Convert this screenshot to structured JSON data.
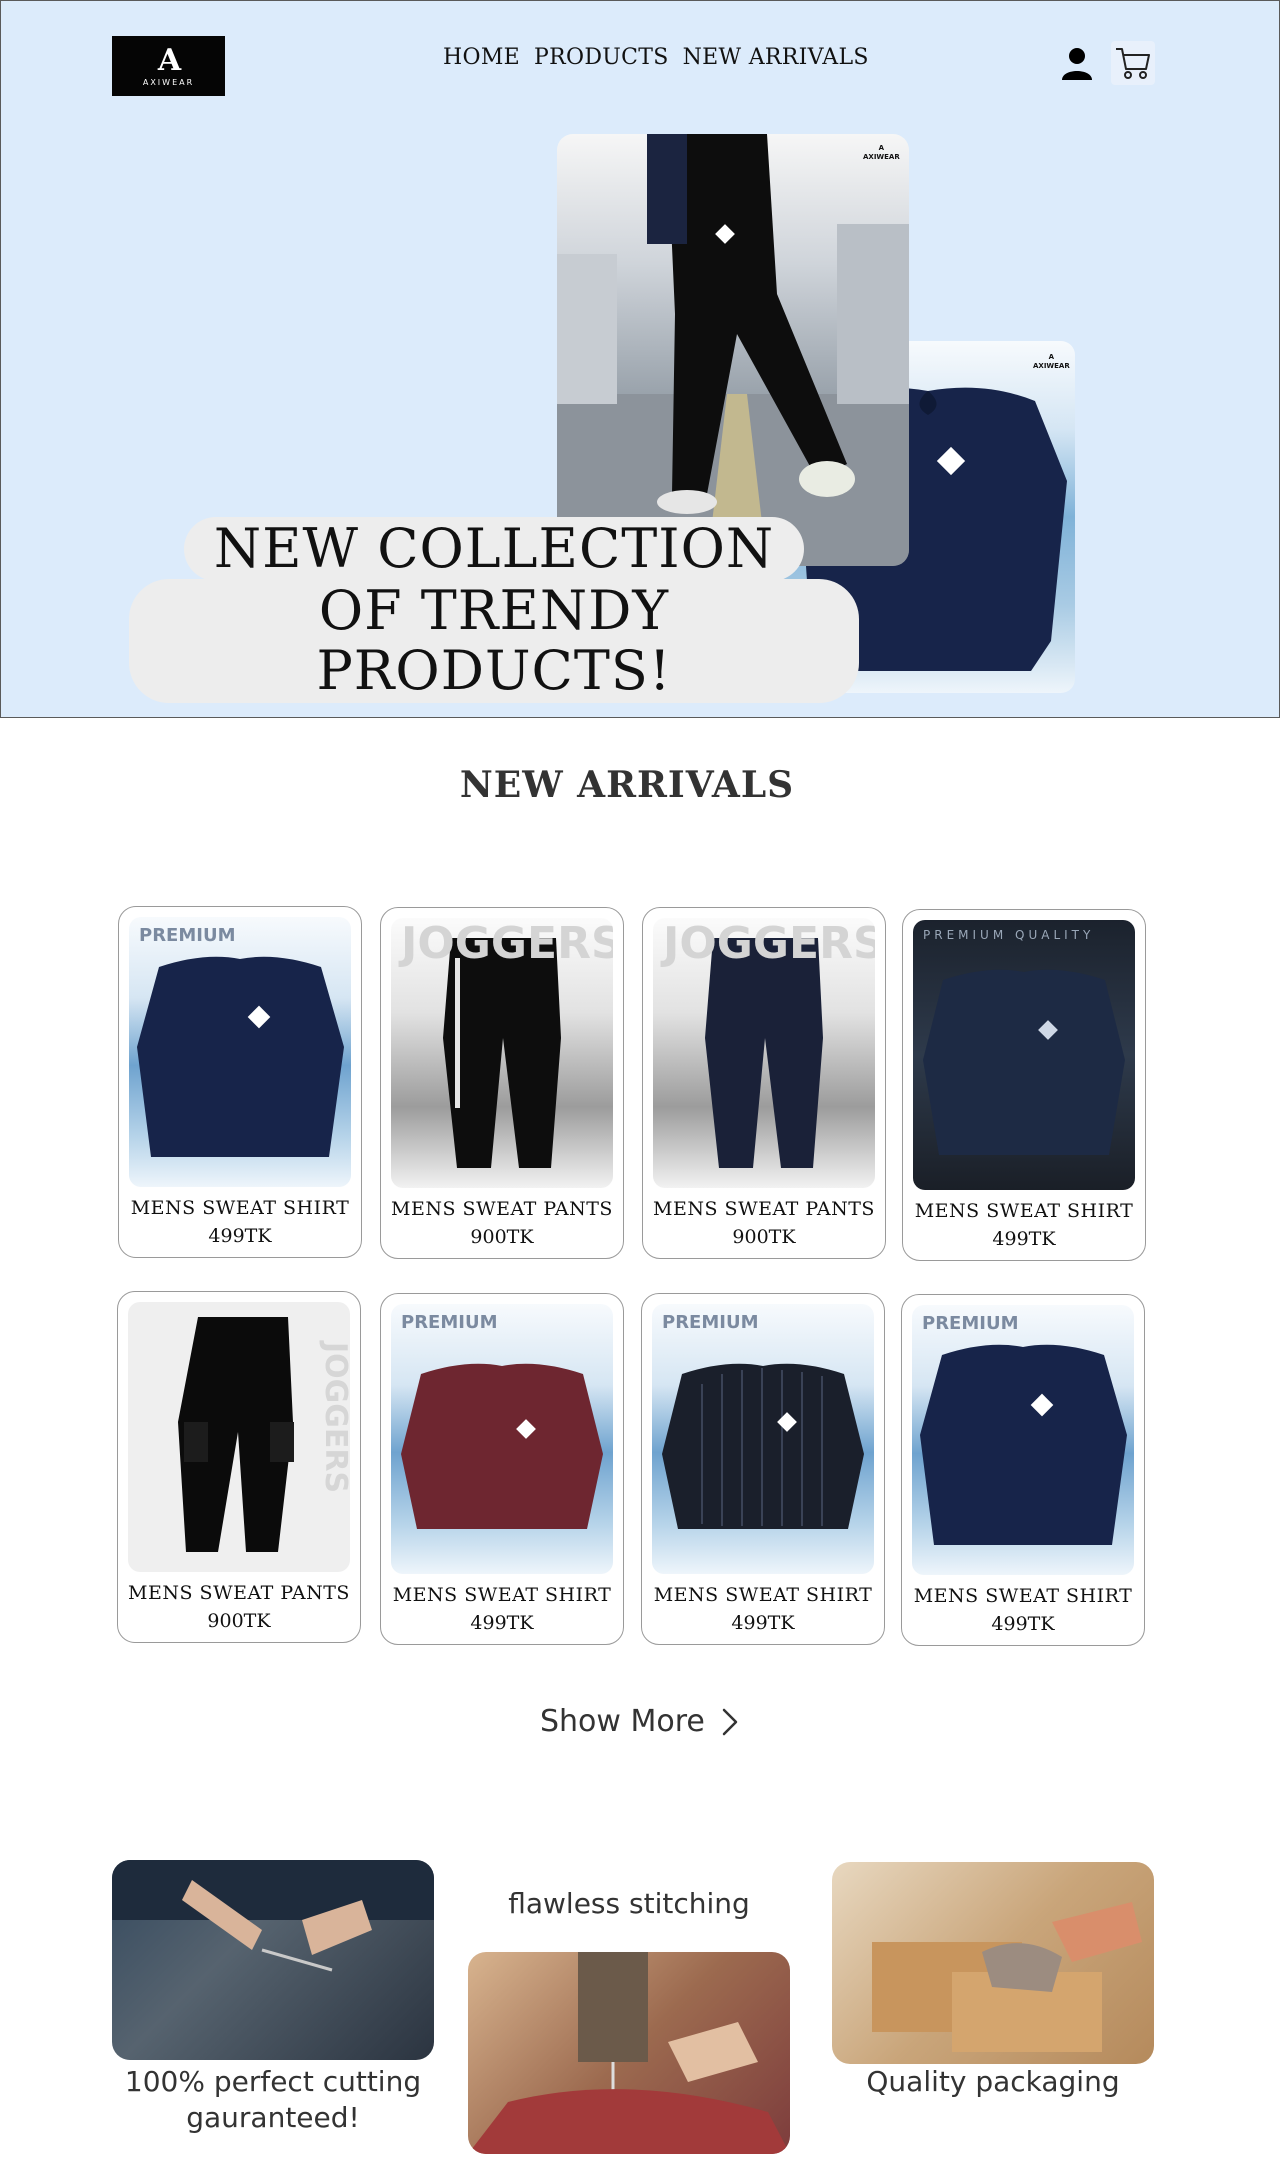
{
  "brand": {
    "logo_mark": "A",
    "logo_text": "AXIWEAR"
  },
  "nav": [
    "HOME",
    "PRODUCTS",
    "NEW ARRIVALS"
  ],
  "hero": {
    "line1": "NEW COLLECTION",
    "line2": "OF TRENDY PRODUCTS!"
  },
  "section_title": "NEW ARRIVALS",
  "products": [
    {
      "name": "MENS SWEAT SHIRT",
      "price": "499TK",
      "image_label": "PREMIUM"
    },
    {
      "name": "MENS SWEAT PANTS",
      "price": "900TK",
      "image_label": "JOGGERS"
    },
    {
      "name": "MENS SWEAT PANTS",
      "price": "900TK",
      "image_label": "JOGGERS"
    },
    {
      "name": "MENS SWEAT SHIRT",
      "price": "499TK",
      "image_label": "PREMIUM QUALITY"
    },
    {
      "name": "MENS SWEAT PANTS",
      "price": "900TK",
      "image_label": "JOGGERS"
    },
    {
      "name": "MENS SWEAT SHIRT",
      "price": "499TK",
      "image_label": "PREMIUM"
    },
    {
      "name": "MENS SWEAT SHIRT",
      "price": "499TK",
      "image_label": "PREMIUM"
    },
    {
      "name": "MENS SWEAT SHIRT",
      "price": "499TK",
      "image_label": "PREMIUM"
    }
  ],
  "show_more": "Show More",
  "features": [
    {
      "caption_line1": "100% perfect cutting",
      "caption_line2": "gauranteed!"
    },
    {
      "caption": "flawless stitching"
    },
    {
      "caption": "Quality packaging"
    }
  ],
  "colors": {
    "hero_bg": "#dcebfb",
    "text": "#111111",
    "card_border": "#9a9a9a",
    "navy": "#17244a"
  },
  "icons": [
    "user-icon",
    "cart-icon",
    "chevron-right-icon"
  ]
}
